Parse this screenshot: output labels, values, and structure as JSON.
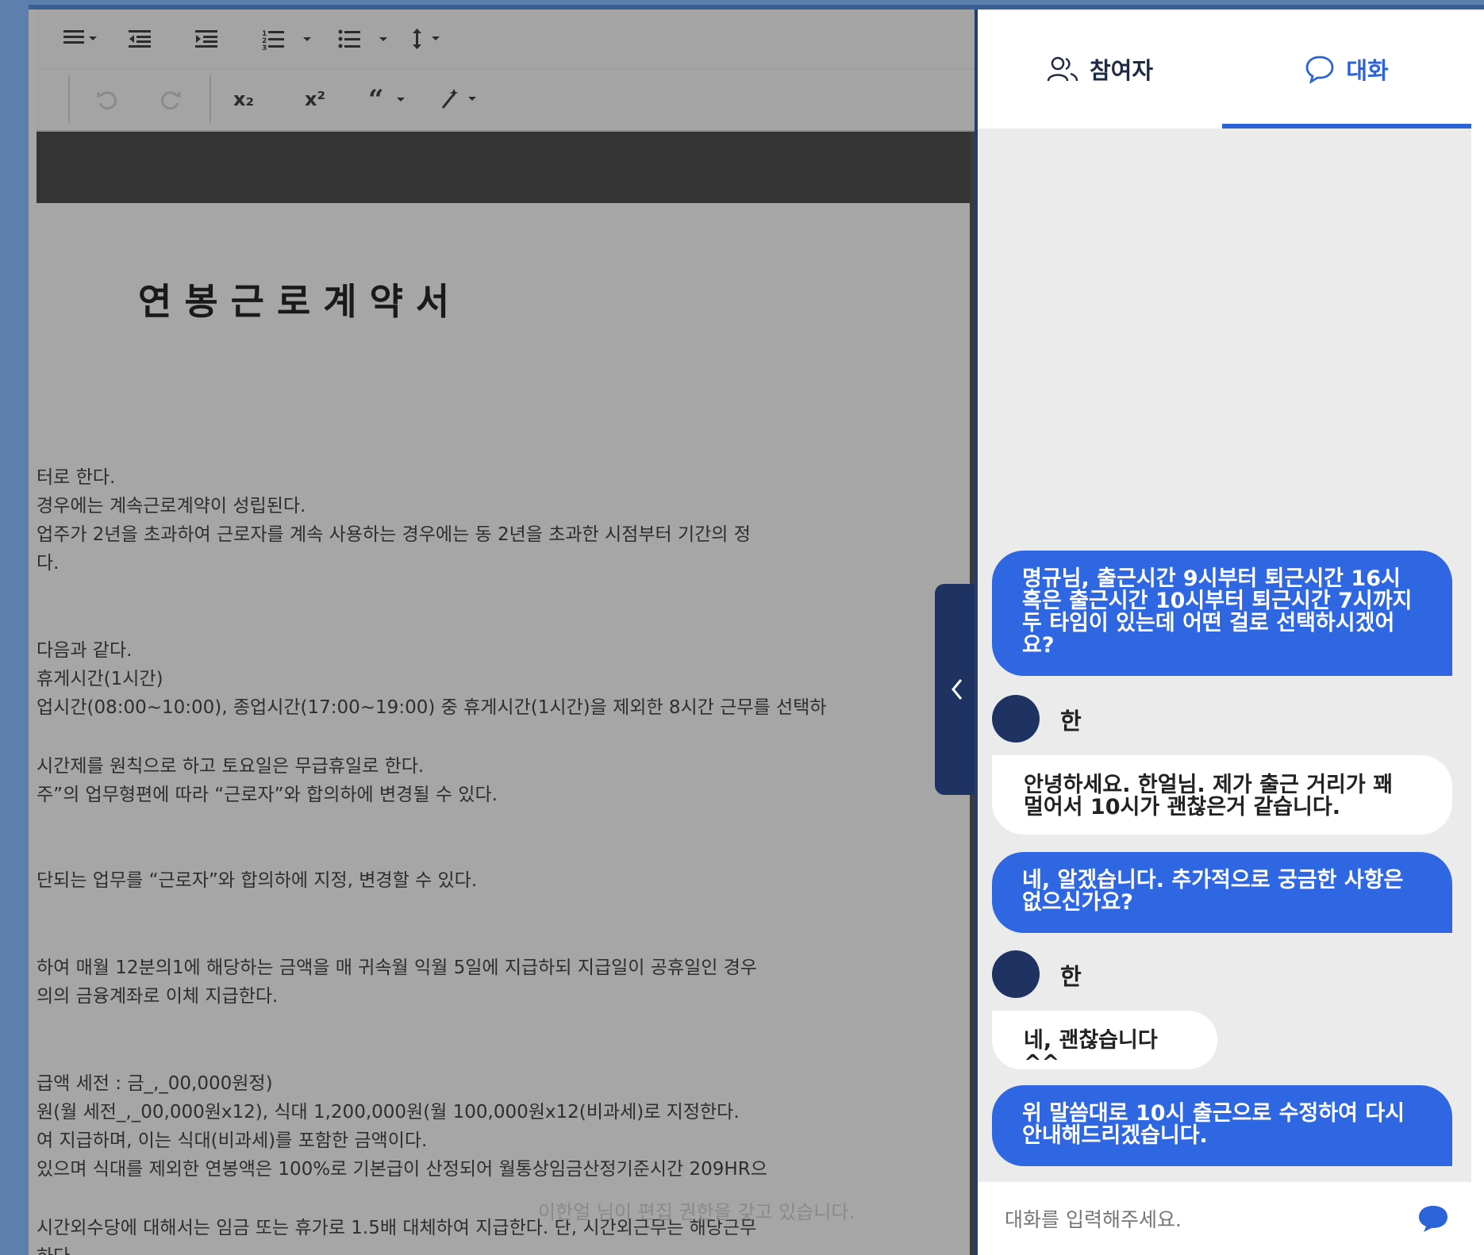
{
  "editor": {
    "toolbar_row1": [
      "align-justify-icon",
      "indent-decrease-icon",
      "indent-increase-icon",
      "ordered-list-icon",
      "unordered-list-icon",
      "line-height-icon"
    ],
    "toolbar_row2": [
      "undo-icon",
      "redo-icon",
      "subscript-icon",
      "superscript-icon",
      "blockquote-icon",
      "magic-wand-icon"
    ],
    "subscript_label": "x₂",
    "superscript_label": "x²",
    "doc_title": "연봉근로계약서",
    "lines": [
      "터로 한다.",
      "경우에는 계속근로계약이 성립된다.",
      "업주가 2년을 초과하여 근로자를 계속 사용하는 경우에는 동 2년을 초과한 시점부터 기간의 정",
      "다.",
      "다음과 같다.",
      "휴게시간(1시간)",
      "업시간(08:00~10:00), 종업시간(17:00~19:00) 중 휴게시간(1시간)을 제외한 8시간 근무를 선택하",
      "시간제를 원칙으로 하고 토요일은 무급휴일로 한다.",
      "주”의 업무형편에 따라 “근로자”와 합의하에 변경될 수 있다.",
      "단되는 업무를 “근로자”와 합의하에 지정, 변경할 수 있다.",
      "하여 매월 12분의1에 해당하는 금액을 매 귀속월 익월 5일에 지급하되 지급일이 공휴일인 경우",
      "의의 금융계좌로 이체 지급한다.",
      "급액 세전 : 금_,_00,000원정)",
      "원(월 세전_,_00,000원x12), 식대 1,200,000원(월 100,000원x12(비과세)로 지정한다.",
      "여 지급하며, 이는 식대(비과세)를 포함한 금액이다.",
      "있으며 식대를 제외한 연봉액은 100%로 기본급이 산정되어 월통상임금산정기준시간 209HR으",
      "시간외수당에 대해서는 임금 또는 휴가로 1.5배 대체하여 지급한다. 단, 시간외근무는 해당근무",
      "하다."
    ],
    "notice": "이한얼 님이 편집 권한을 갖고 있습니다."
  },
  "chat": {
    "tabs": [
      {
        "label": "참여자",
        "icon": "participants-icon"
      },
      {
        "label": "대화",
        "icon": "speech-bubble-icon"
      }
    ],
    "messages": [
      {
        "from": "me",
        "text": [
          "명규님, 출근시간 9시부터 퇴근시간 16시",
          "혹은 출근시간 10시부터 퇴근시간 7시까지",
          "두 타임이 있는데 어떤 걸로 선택하시겠어",
          "요?"
        ]
      },
      {
        "from": "other",
        "sender": "한",
        "text": [
          "안녕하세요. 한얼님. 제가 출근 거리가 꽤",
          "멀어서 10시가 괜찮은거 같습니다."
        ]
      },
      {
        "from": "me",
        "text": [
          "네, 알겠습니다. 추가적으로 궁금한 사항은",
          "없으신가요?"
        ]
      },
      {
        "from": "other",
        "sender": "한",
        "text": [
          "네, 괜찮습니다^^"
        ]
      },
      {
        "from": "me",
        "text": [
          "위 말씀대로 10시 출근으로 수정하여 다시",
          "안내해드리겠습니다."
        ]
      }
    ],
    "input_placeholder": "대화를 입력해주세요.",
    "accent_color": "#2f67e3",
    "avatar_color": "#1e3361"
  }
}
